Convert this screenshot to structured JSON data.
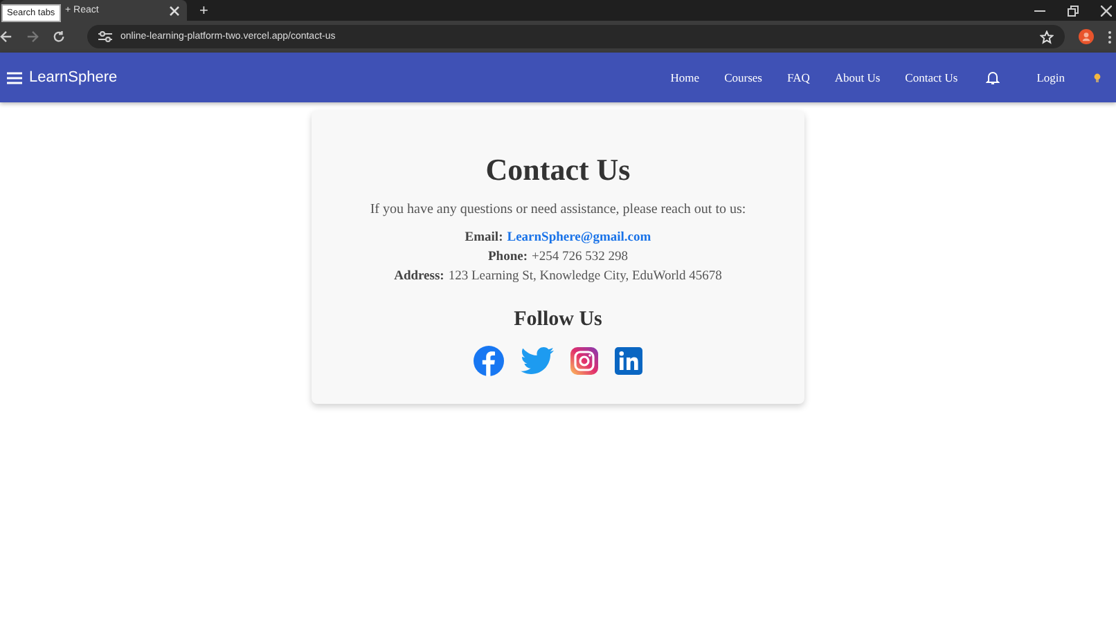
{
  "browser": {
    "tab_title": "+ React",
    "tooltip": "Search tabs",
    "new_tab": "+",
    "url": "online-learning-platform-two.vercel.app/contact-us"
  },
  "navbar": {
    "brand": "LearnSphere",
    "links": [
      {
        "label": "Home"
      },
      {
        "label": "Courses"
      },
      {
        "label": "FAQ"
      },
      {
        "label": "About Us"
      },
      {
        "label": "Contact Us"
      }
    ],
    "login": "Login"
  },
  "contact": {
    "title": "Contact Us",
    "intro": "If you have any questions or need assistance, please reach out to us:",
    "lines": [
      {
        "kind": "link",
        "label": "Email:",
        "value": "LearnSphere@gmail.com"
      },
      {
        "kind": "text",
        "text": "**Phone:** +254 726 532 298"
      },
      {
        "kind": "text",
        "text": "**Address:** 123 Learning St, Knowledge City, EduWorld 45678"
      }
    ],
    "follow_title": "Follow Us"
  }
}
